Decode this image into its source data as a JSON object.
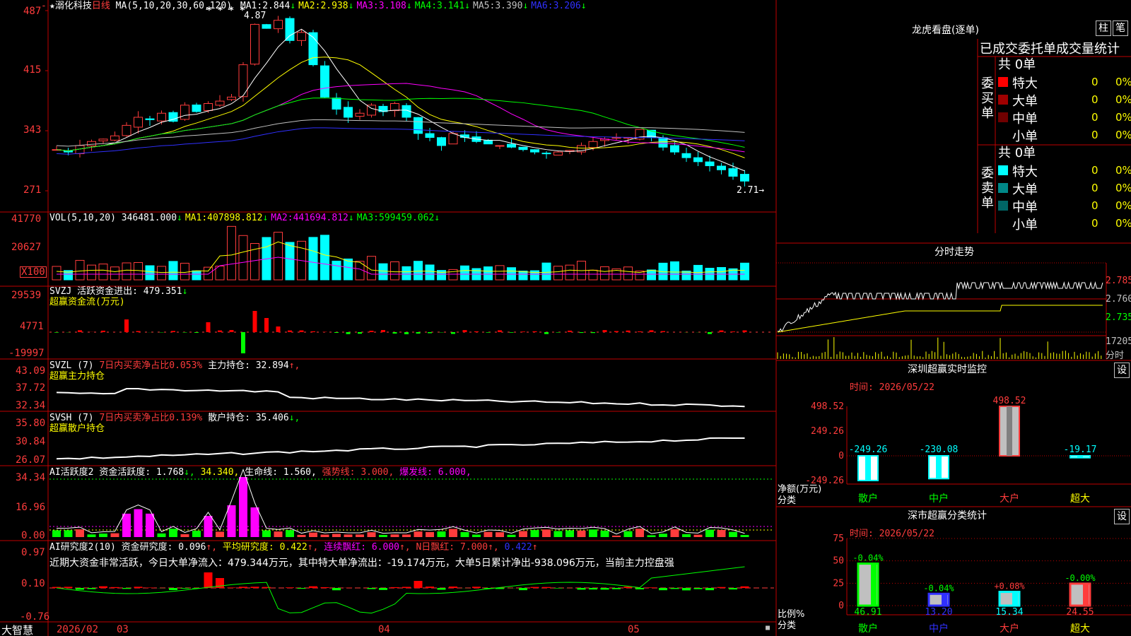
{
  "header": {
    "stock_name": "★溺化科技",
    "period": "日线",
    "ma_label": "MA(5,10,20,30,60,120)",
    "ma": [
      {
        "label": "MA1:",
        "value": "2.844",
        "arrow": "↓",
        "color": "#ffffff"
      },
      {
        "label": "MA2:",
        "value": "2.938",
        "arrow": "↓",
        "color": "#ffff00"
      },
      {
        "label": "MA3:",
        "value": "3.108",
        "arrow": "↓",
        "color": "#ff00ff"
      },
      {
        "label": "MA4:",
        "value": "3.141",
        "arrow": "↓",
        "color": "#00ff00"
      },
      {
        "label": "MA5:",
        "value": "3.390",
        "arrow": "↓",
        "color": "#c0c0c0"
      },
      {
        "label": "MA6:",
        "value": "3.206",
        "arrow": "↓",
        "color": "#3030ff"
      }
    ],
    "high_label": "4.87",
    "stars": "* * * *",
    "low_label": "2.71→",
    "top_left_mark": "-"
  },
  "price_axis": [
    "487",
    "415",
    "343",
    "271"
  ],
  "vol": {
    "title": "VOL(5,10,20)",
    "value": "346481.000",
    "arrow": "↓",
    "ma": [
      {
        "label": "MA1:",
        "value": "407898.812",
        "arrow": "↓",
        "color": "#ffff00"
      },
      {
        "label": "MA2:",
        "value": "441694.812",
        "arrow": "↓",
        "color": "#ff00ff"
      },
      {
        "label": "MA3:",
        "value": "599459.062",
        "arrow": "↓",
        "color": "#00ff00"
      }
    ],
    "axis": [
      "41770",
      "20627"
    ],
    "unit": "X100"
  },
  "svzj": {
    "title": "SVZJ",
    "label": "活跃资金进出:",
    "value": "479.351",
    "arrow": "↓",
    "subtitle": "超赢资金流(万元)",
    "axis": [
      "29539",
      "4771",
      "-19997"
    ]
  },
  "svzl": {
    "title": "SVZL (7)",
    "ratio_label": "7日内买卖净占比0.053%",
    "hold_label": "主力持仓:",
    "hold_value": "32.894",
    "arrow": "↑,",
    "subtitle": "超赢主力持仓",
    "axis": [
      "43.09",
      "37.72",
      "32.34"
    ]
  },
  "svsh": {
    "title": "SVSH (7)",
    "ratio_label": "7日内买卖净占比0.139%",
    "hold_label": "散户持仓:",
    "hold_value": "35.406",
    "arrow": "↓,",
    "subtitle": "超赢散户持仓",
    "axis": [
      "35.80",
      "30.84",
      "26.07"
    ]
  },
  "ai1": {
    "title": "AI活跃度2",
    "label": "资金活跃度:",
    "value1": "1.768",
    "arrow1": "↓,",
    "value2": "34.340,",
    "life_label": "生命线:",
    "life_value": "1.560,",
    "strong_label": "强势线:",
    "strong_value": "3.000,",
    "burst_label": "爆发线:",
    "burst_value": "6.000,",
    "axis": [
      "34.34",
      "16.96",
      "0.00"
    ]
  },
  "ai2": {
    "title": "AI研究度2(10)",
    "label": "资金研究度:",
    "value": "0.096",
    "arrow": "↑,",
    "avg_label": "平均研究度:",
    "avg_value": "0.422",
    "avg_arrow": "↑,",
    "streak_label": "连续飘红:",
    "streak_value": "6.000",
    "streak_arrow": "↑,",
    "n_label": "N日飘红:",
    "n_value": "7.000",
    "n_arrow": "↑,",
    "last_value": "0.422",
    "last_arrow": "↑",
    "comment": "近期大资金非常活跃，今日大单净流入：479.344万元，其中特大单净流出：-19.174万元，大单5日累计净出-938.096万元，当前主力控盘强",
    "axis": [
      "0.97",
      "0.10",
      "-0.76"
    ]
  },
  "date_axis": {
    "app_name": "大智慧",
    "labels": [
      "2026/02",
      "03",
      "04",
      "05"
    ]
  },
  "dragon": {
    "title": "龙虎看盘(逐单)",
    "btn_col": "柱",
    "btn_pen": "笔",
    "subtitle": "已成交委托单成交量统计",
    "buy": {
      "side_label": "委买单",
      "total": "共 0单",
      "rows": [
        {
          "name": "特大",
          "count": "0",
          "pct": "0%",
          "color": "#ff0000"
        },
        {
          "name": "大单",
          "count": "0",
          "pct": "0%",
          "color": "#a00000"
        },
        {
          "name": "中单",
          "count": "0",
          "pct": "0%",
          "color": "#700000"
        },
        {
          "name": "小单",
          "count": "0",
          "pct": "0%",
          "color": "#000000"
        }
      ]
    },
    "sell": {
      "side_label": "委卖单",
      "total": "共 0单",
      "rows": [
        {
          "name": "特大",
          "count": "0",
          "pct": "0%",
          "color": "#00ffff"
        },
        {
          "name": "大单",
          "count": "0",
          "pct": "0%",
          "color": "#008888"
        },
        {
          "name": "中单",
          "count": "0",
          "pct": "0%",
          "color": "#006666"
        },
        {
          "name": "小单",
          "count": "0",
          "pct": "0%",
          "color": "#000000"
        }
      ]
    }
  },
  "intraday": {
    "title": "分时走势",
    "axis": [
      "2.785",
      "2.760",
      "2.735"
    ],
    "vol_axis": "17205",
    "vol_unit": "分时"
  },
  "monitor": {
    "title": "深圳超赢实时监控",
    "btn": "设",
    "time": "时间: 2026/05/22",
    "axis_label": "净额(万元)",
    "axis_sub": "分类",
    "chart_data": {
      "type": "bar",
      "categories": [
        "散户",
        "中户",
        "大户",
        "超大"
      ],
      "values": [
        -249.26,
        -230.08,
        498.52,
        -19.17
      ],
      "value_labels": [
        "-249.26",
        "-230.08",
        "498.52",
        "-19.17"
      ],
      "yticks": [
        "498.52",
        "249.26",
        "0",
        "-249.26"
      ],
      "ylim": [
        -249.26,
        498.52
      ]
    }
  },
  "classify": {
    "title": "深市超赢分类统计",
    "btn": "设",
    "time": "时间: 2026/05/22",
    "axis_label": "比例%",
    "axis_sub": "分类",
    "chart_data": {
      "type": "bar",
      "categories": [
        "散户",
        "中户",
        "大户",
        "超大"
      ],
      "values": [
        46.91,
        13.2,
        15.34,
        24.55
      ],
      "value_labels": [
        "46.91",
        "13.20",
        "15.34",
        "24.55"
      ],
      "changes": [
        "-0.04%",
        "-0.04%",
        "+0.08%",
        "-0.00%"
      ],
      "yticks": [
        "75",
        "50",
        "25",
        "0"
      ],
      "ylim": [
        0,
        75
      ]
    }
  }
}
